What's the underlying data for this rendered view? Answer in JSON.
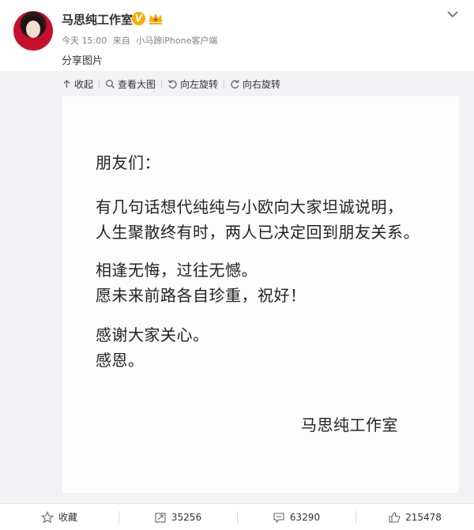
{
  "post": {
    "username": "马思纯工作室",
    "verified_mark": "V",
    "time": "今天 15:00",
    "from_label": "来自",
    "source": "小马蹄iPhone客户端",
    "text": "分享图片"
  },
  "toolbar": {
    "collapse": "收起",
    "view_large": "查看大图",
    "rotate_left": "向左旋转",
    "rotate_right": "向右旋转"
  },
  "letter": {
    "greeting": "朋友们：",
    "p1_l1": "有几句话想代纯纯与小欧向大家坦诚说明，",
    "p1_l2": "人生聚散终有时，两人已决定回到朋友关系。",
    "p2_l1": "相逢无悔，过往无憾。",
    "p2_l2": "愿未来前路各自珍重，祝好！",
    "p3_l1": "感谢大家关心。",
    "p3_l2": "感恩。",
    "signature": "马思纯工作室"
  },
  "footer": {
    "favorite": "收藏",
    "repost_count": "35256",
    "comment_count": "63290",
    "like_count": "215478"
  },
  "colors": {
    "verified": "#f7ac00",
    "meta": "#808080",
    "media_bg": "#f2f2f5"
  }
}
